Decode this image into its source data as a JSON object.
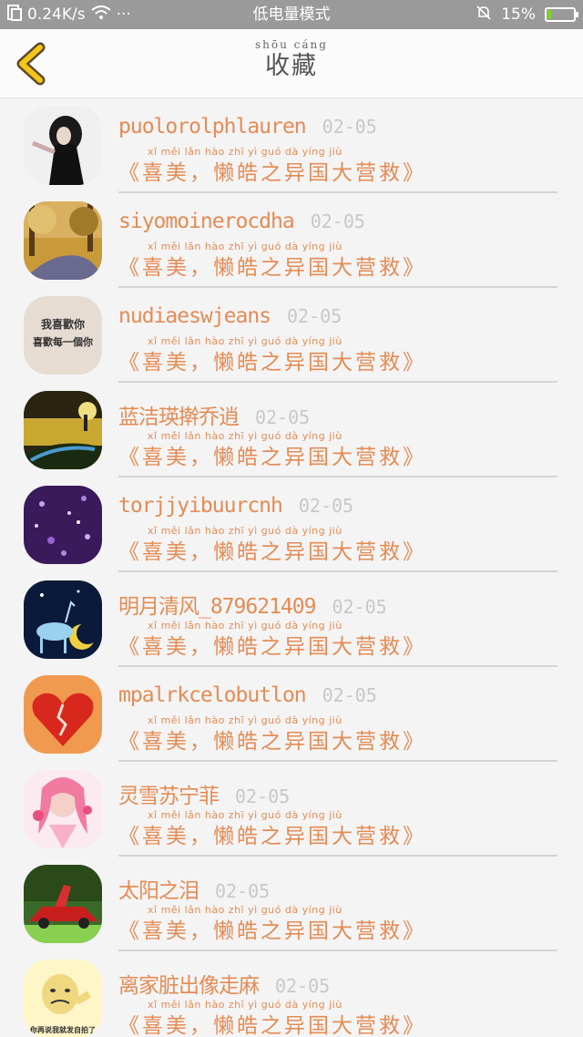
{
  "status_bar": {
    "network_speed": "0.24K/s",
    "mode_label": "低电量模式",
    "battery_percent": "15%",
    "battery_level": 0.15,
    "dots": "···"
  },
  "header": {
    "title_pinyin": "shōu cáng",
    "title": "收藏"
  },
  "message_text": "《喜美，懒皓之异国大营救》",
  "message_pinyin": "xǐ  měi          lǎn  hào  zhī   yì   guó  dà   yíng  jiù",
  "items": [
    {
      "name": "puolorolphlauren",
      "date": "02-05"
    },
    {
      "name": "siyomoinerocdha",
      "date": "02-05"
    },
    {
      "name": "nudiaeswjeans",
      "date": "02-05"
    },
    {
      "name": "蓝洁瑛擀乔逍",
      "date": "02-05"
    },
    {
      "name": "torjjyibuurcnh",
      "date": "02-05"
    },
    {
      "name": "明月清风_879621409",
      "date": "02-05"
    },
    {
      "name": "mpalrkcelobutlon",
      "date": "02-05"
    },
    {
      "name": "灵雪苏宁菲",
      "date": "02-05"
    },
    {
      "name": "太阳之泪",
      "date": "02-05"
    },
    {
      "name": "离家脏出像走麻",
      "date": "02-05"
    }
  ],
  "avatar_texts": {
    "love_line1": "我喜歡你",
    "love_line2": "喜歡每一個你",
    "meme_caption": "你再说我就发自拍了"
  },
  "colors": {
    "accent": "#e48c55",
    "back_arrow": "#f5c518",
    "date": "#c8c8c8"
  }
}
